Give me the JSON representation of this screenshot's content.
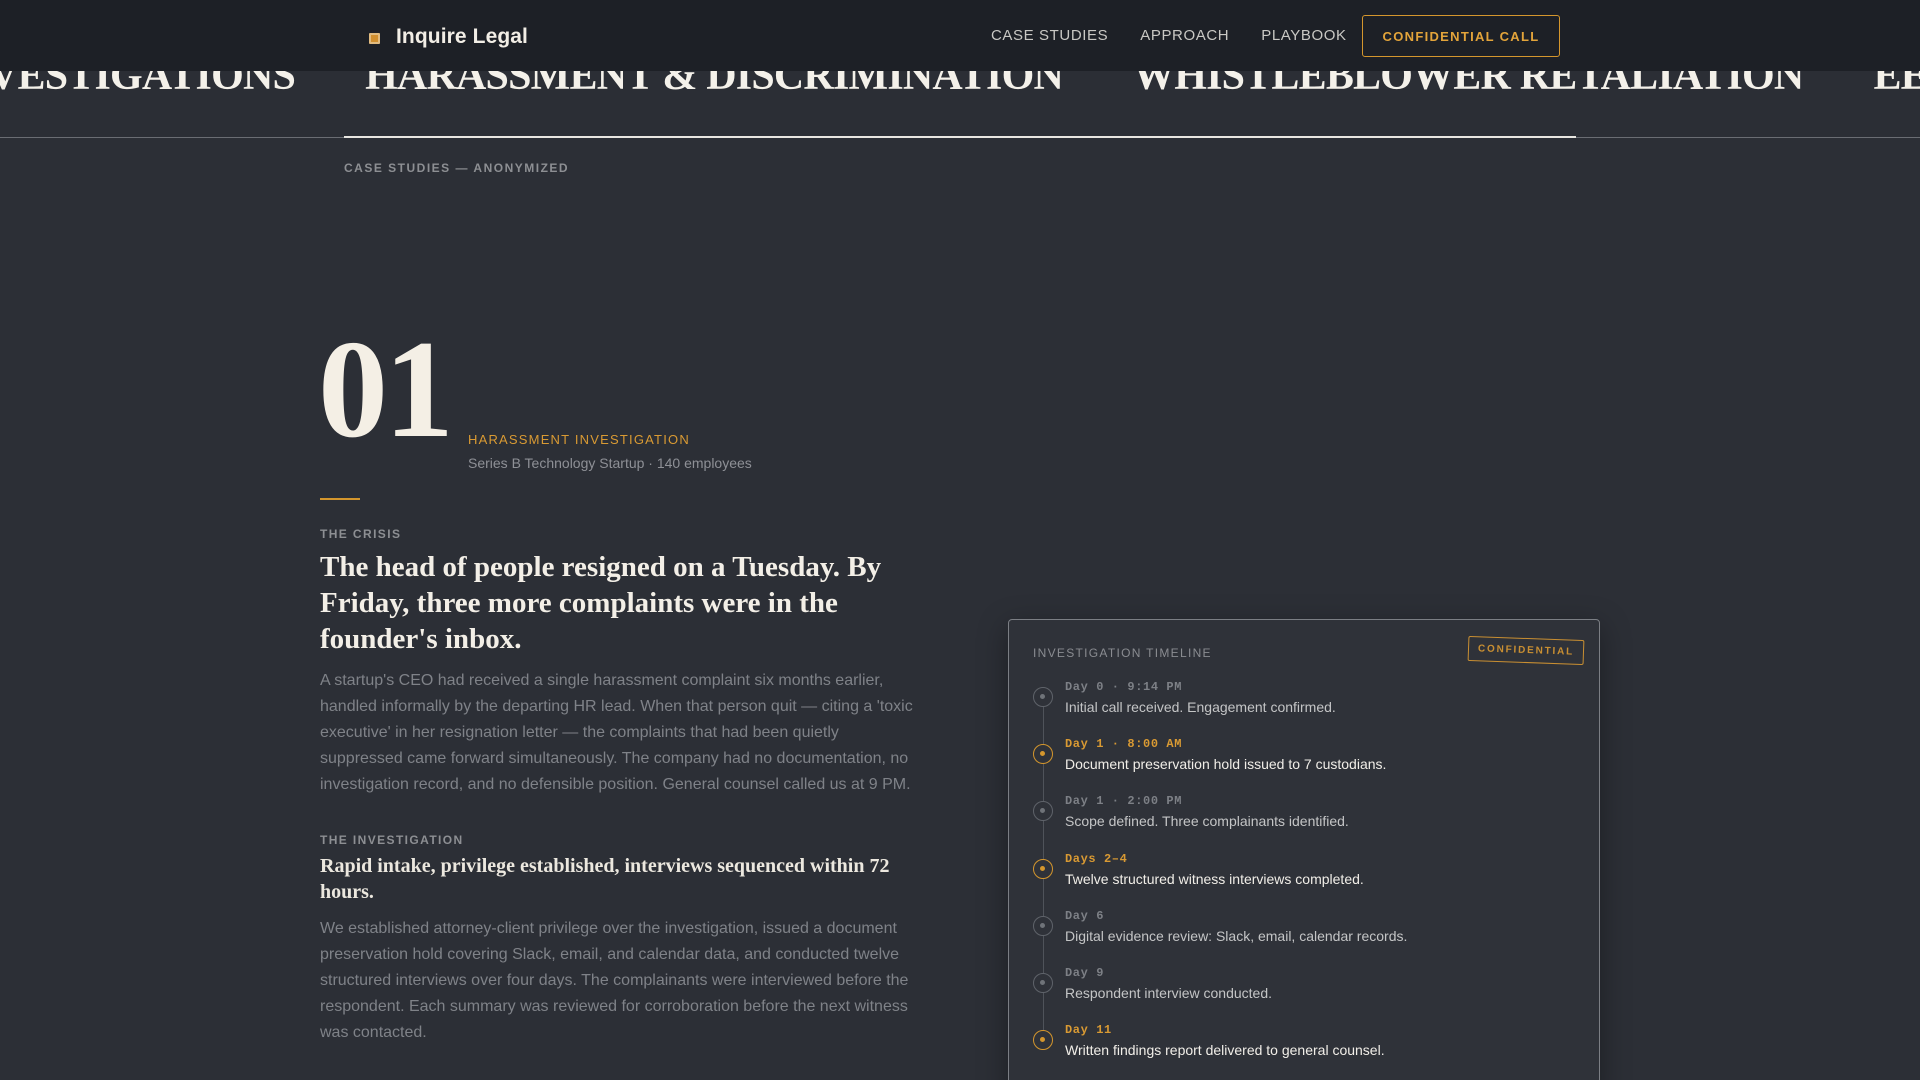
{
  "header": {
    "brand": "Inquire Legal",
    "nav": [
      "CASE STUDIES",
      "APPROACH",
      "PLAYBOOK"
    ],
    "cta": "CONFIDENTIAL CALL"
  },
  "marquee": {
    "items": [
      "VESTIGATIONS",
      "HARASSMENT & DISCRIMINATION",
      "WHISTLEBLOWER RETALIATION",
      "EEOC RESPONSE"
    ]
  },
  "section_label": "CASE STUDIES — ANONYMIZED",
  "case": {
    "number": "01",
    "kicker": "HARASSMENT INVESTIGATION",
    "company": "Series B Technology Startup · 140 employees",
    "crisis_label": "THE CRISIS",
    "crisis_headline": "The head of people resigned on a Tuesday. By Friday, three more complaints were in the founder's inbox.",
    "crisis_body": "A startup's CEO had received a single harassment complaint six months earlier, handled informally by the departing HR lead. When that person quit — citing a 'toxic executive' in her resignation letter — the complaints that had been quietly suppressed came forward simultaneously. The company had no documentation, no investigation record, and no defensible position. General counsel called us at 9 PM.",
    "investigation_label": "THE INVESTIGATION",
    "investigation_headline": "Rapid intake, privilege established, interviews sequenced within 72 hours.",
    "investigation_body": "We established attorney-client privilege over the investigation, issued a document preservation hold covering Slack, email, and calendar data, and conducted twelve structured interviews over four days. The complainants were interviewed before the respondent. Each summary was reviewed for corroboration before the next witness was contacted."
  },
  "timeline": {
    "title": "INVESTIGATION TIMELINE",
    "stamp": "CONFIDENTIAL",
    "items": [
      {
        "time": "Day 0 · 9:14 PM",
        "desc": "Initial call received. Engagement confirmed.",
        "key": false
      },
      {
        "time": "Day 1 · 8:00 AM",
        "desc": "Document preservation hold issued to 7 custodians.",
        "key": true
      },
      {
        "time": "Day 1 · 2:00 PM",
        "desc": "Scope defined. Three complainants identified.",
        "key": false
      },
      {
        "time": "Days 2–4",
        "desc": "Twelve structured witness interviews completed.",
        "key": true
      },
      {
        "time": "Day 6",
        "desc": "Digital evidence review: Slack, email, calendar records.",
        "key": false
      },
      {
        "time": "Day 9",
        "desc": "Respondent interview conducted.",
        "key": false
      },
      {
        "time": "Day 11",
        "desc": "Written findings report delivered to general counsel.",
        "key": true
      }
    ]
  },
  "colors": {
    "accent": "#d4962d",
    "background": "#2c2f36",
    "header": "#1d2026"
  }
}
